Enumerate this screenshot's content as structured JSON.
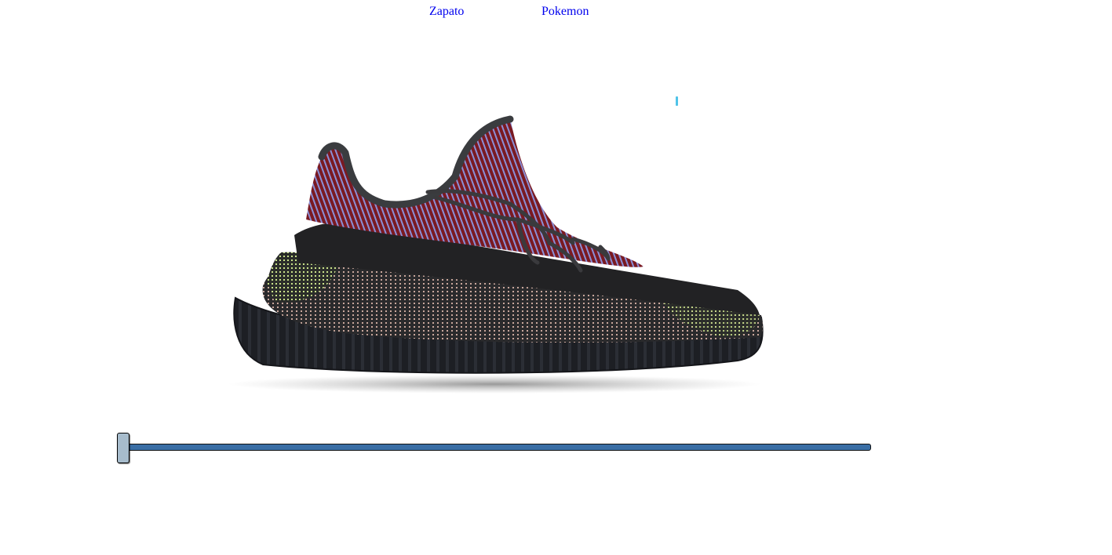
{
  "nav": {
    "links": [
      {
        "label": "Zapato"
      },
      {
        "label": "Pokemon"
      }
    ]
  },
  "viewer": {
    "image_subject": "sneaker",
    "indicator_color": "#4fc3e8"
  },
  "slider": {
    "value_fraction": 0.0,
    "track_color": "#3a6ea5",
    "thumb_color": "#a7bccc"
  }
}
